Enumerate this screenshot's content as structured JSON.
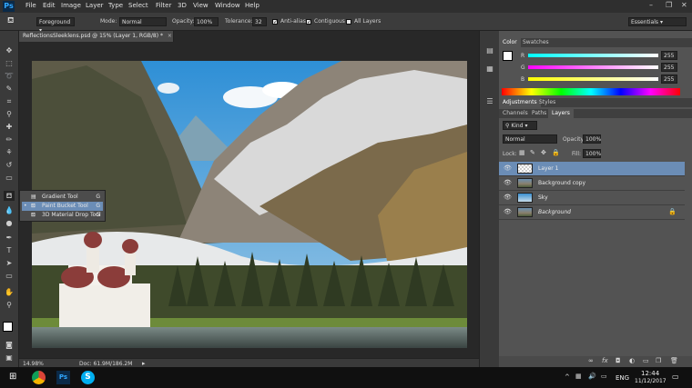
{
  "app": {
    "logo": "Ps"
  },
  "menu": [
    "File",
    "Edit",
    "Image",
    "Layer",
    "Type",
    "Select",
    "Filter",
    "3D",
    "View",
    "Window",
    "Help"
  ],
  "window_controls": [
    "–",
    "❐",
    "✕"
  ],
  "options": {
    "mode_preset": "Foreground",
    "mode_label": "Mode:",
    "mode_value": "Normal",
    "opacity_label": "Opacity:",
    "opacity_value": "100%",
    "tolerance_label": "Tolerance:",
    "tolerance_value": "32",
    "anti_alias_label": "Anti-alias",
    "contiguous_label": "Contiguous",
    "all_layers_label": "All Layers",
    "workspace": "Essentials"
  },
  "document": {
    "tab_title": "ReflectionsSleeklens.psd @ 15% (Layer 1, RGB/8) *",
    "zoom": "14.98%",
    "doc_size": "Doc: 61.9M/186.2M"
  },
  "tool_flyout": {
    "items": [
      "Gradient Tool",
      "Paint Bucket Tool",
      "3D Material Drop Tool"
    ],
    "shortcut": "G",
    "selected_index": 1
  },
  "color_panel": {
    "tabs": [
      "Color",
      "Swatches"
    ],
    "channels": [
      {
        "name": "R",
        "value": "255",
        "color": "#ff3b3b"
      },
      {
        "name": "G",
        "value": "255",
        "color": "#3bff3b"
      },
      {
        "name": "B",
        "value": "255",
        "color": "#3b8bff"
      }
    ]
  },
  "adjustments_panel": {
    "tabs": [
      "Adjustments",
      "Styles"
    ]
  },
  "layers_panel": {
    "tabs": [
      "Channels",
      "Paths",
      "Layers"
    ],
    "filter_label": "Kind",
    "blend_mode": "Normal",
    "opacity_label": "Opacity:",
    "opacity_value": "100%",
    "lock_label": "Lock:",
    "fill_label": "Fill:",
    "fill_value": "100%",
    "layers": [
      {
        "name": "Layer 1",
        "selected": true
      },
      {
        "name": "Background copy",
        "selected": false
      },
      {
        "name": "Sky",
        "selected": false
      },
      {
        "name": "Background",
        "selected": false
      }
    ]
  },
  "taskbar": {
    "time": "12:44",
    "date": "11/12/2017",
    "language": "ENG"
  }
}
